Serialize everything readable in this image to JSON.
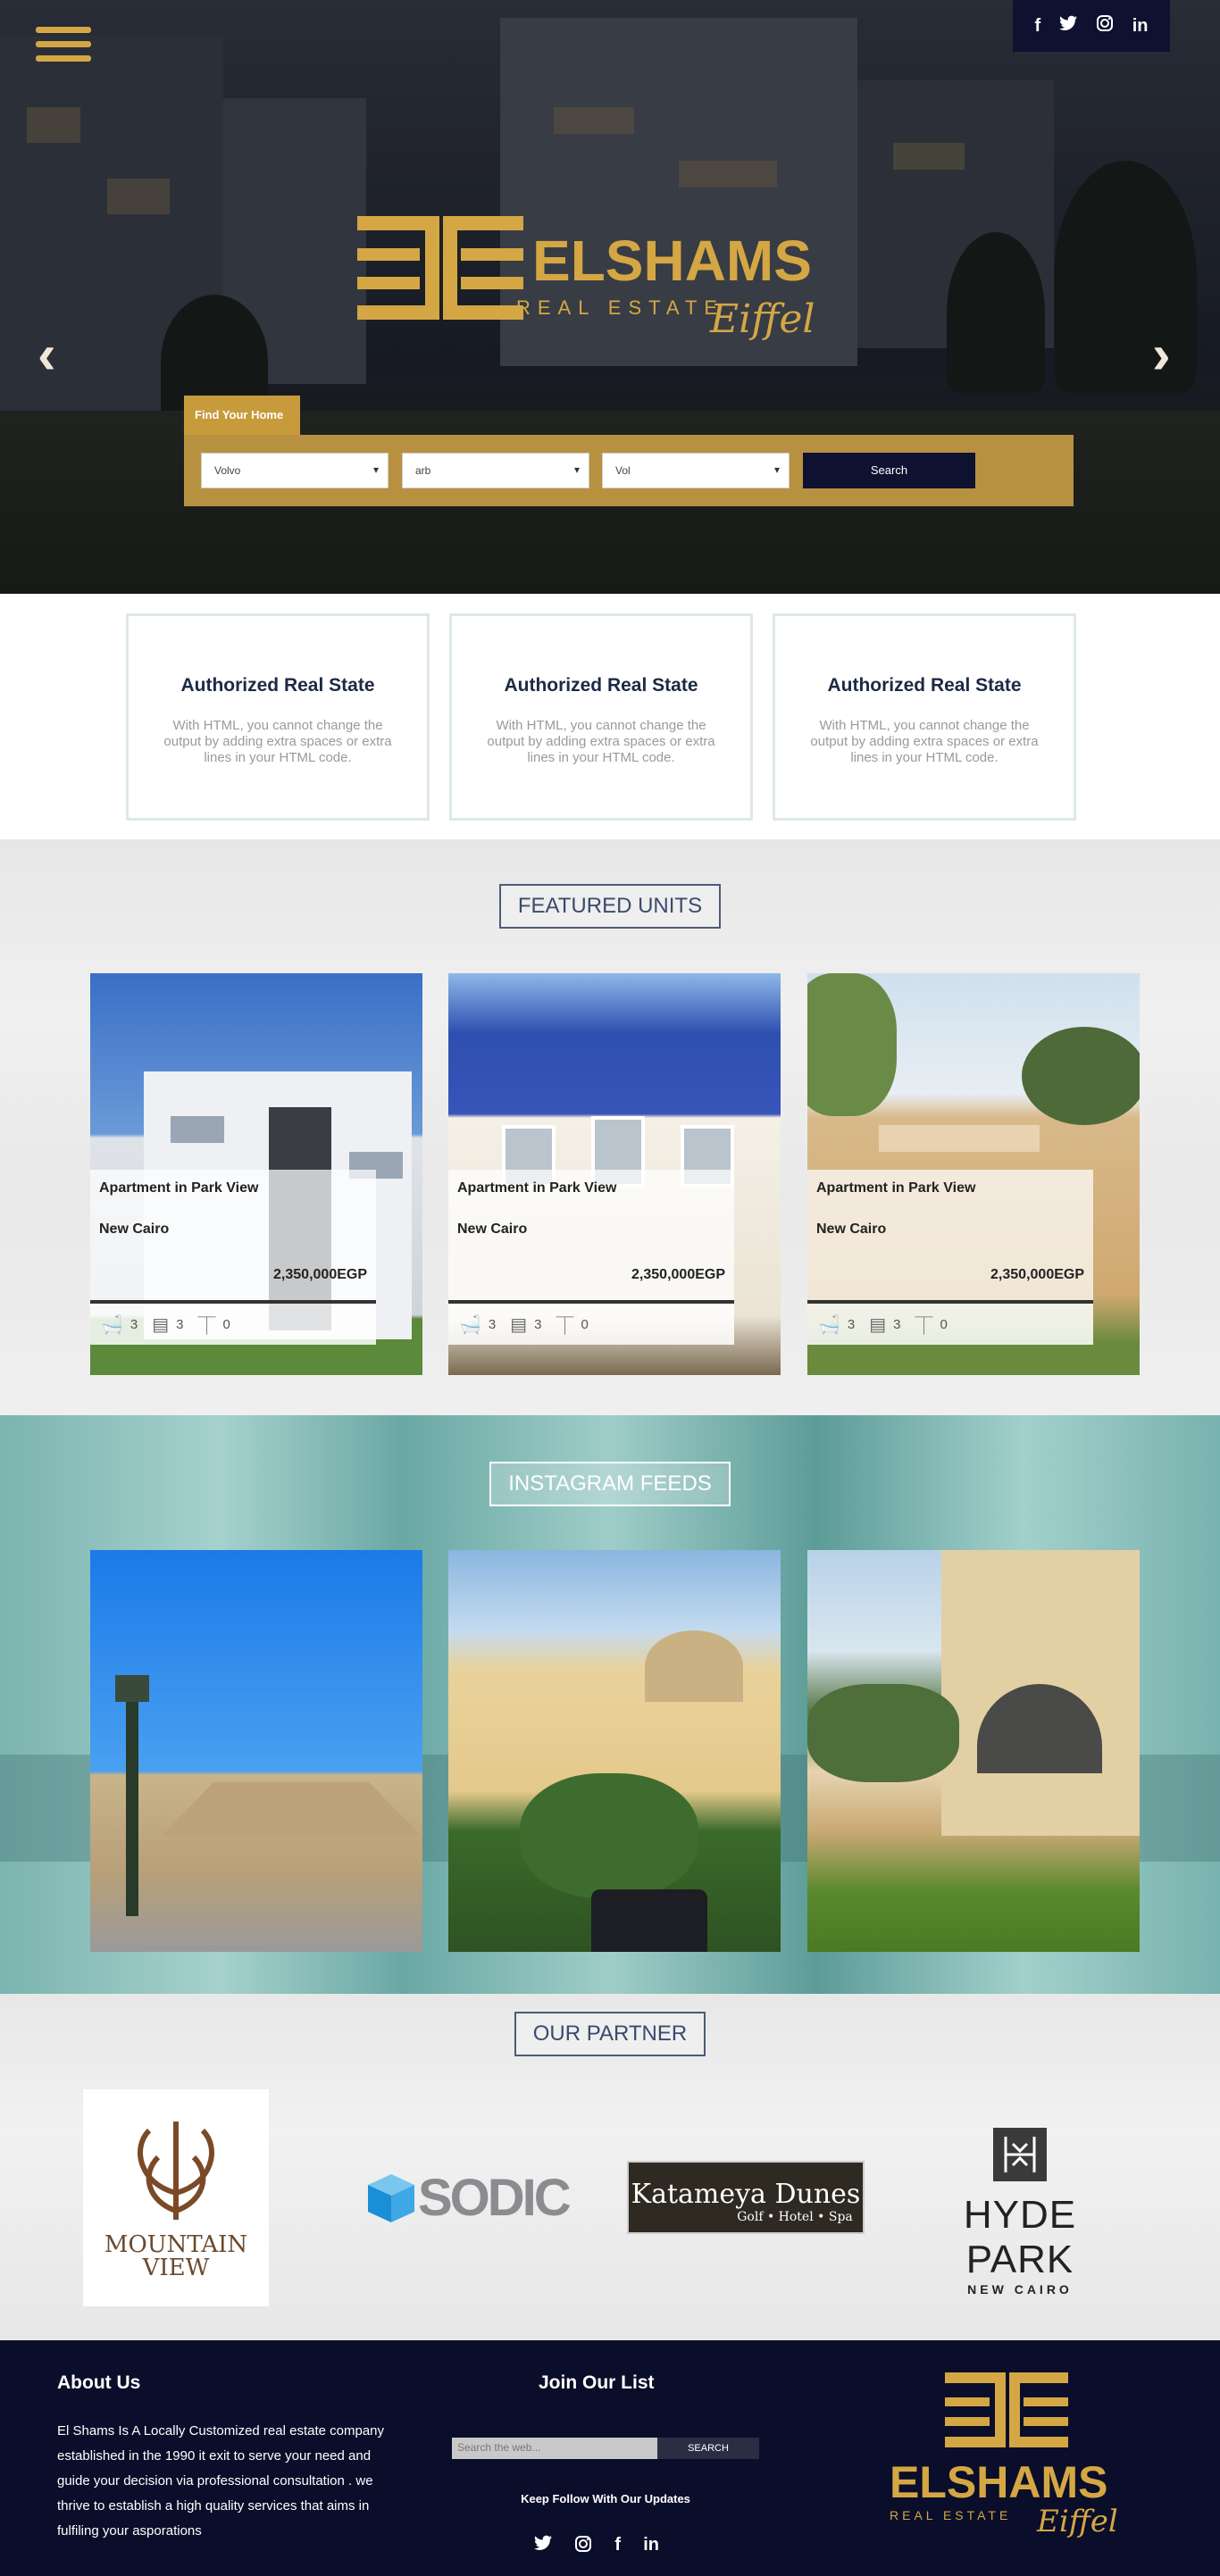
{
  "header": {
    "social": [
      {
        "name": "facebook-icon",
        "glyph": "f"
      },
      {
        "name": "twitter-icon",
        "glyph": "🐦"
      },
      {
        "name": "instagram-icon",
        "glyph": "◎"
      },
      {
        "name": "linkedin-icon",
        "glyph": "in"
      }
    ],
    "logo": {
      "brand": "ELSHAMS",
      "sub": "REAL ESTATE",
      "script": "Eiffel"
    },
    "prev_arrow": "‹",
    "next_arrow": "›"
  },
  "search": {
    "tab_label": "Find Your Home",
    "select1": "Volvo",
    "select2": "arb",
    "select3": "Vol",
    "button": "Search"
  },
  "features": [
    {
      "title": "Authorized Real State",
      "text": "With HTML, you cannot change the output by adding extra spaces or extra lines in your HTML code."
    },
    {
      "title": "Authorized Real State",
      "text": "With HTML, you cannot change the output by adding extra spaces or extra lines in your HTML code."
    },
    {
      "title": "Authorized Real State",
      "text": "With HTML, you cannot change the output by adding extra spaces or extra lines in your HTML code."
    }
  ],
  "units": {
    "title": "FEATURED UNITS",
    "cards": [
      {
        "title": "Apartment in Park View",
        "location": "New Cairo",
        "price": "2,350,000EGP",
        "baths": "3",
        "beds": "3",
        "other": "0"
      },
      {
        "title": "Apartment in Park View",
        "location": "New Cairo",
        "price": "2,350,000EGP",
        "baths": "3",
        "beds": "3",
        "other": "0"
      },
      {
        "title": "Apartment in Park View",
        "location": "New Cairo",
        "price": "2,350,000EGP",
        "baths": "3",
        "beds": "3",
        "other": "0"
      }
    ]
  },
  "instagram": {
    "title": "INSTAGRAM FEEDS"
  },
  "partners": {
    "title": "OUR PARTNER",
    "mountain": {
      "line1": "MOUNTAIN",
      "line2": "VIEW"
    },
    "sodic": "SODIC",
    "katameya": {
      "name": "Katameya Dunes",
      "tag": "Golf • Hotel • Spa"
    },
    "hydepark": {
      "name": "HYDE PARK",
      "sub": "NEW CAIRO"
    }
  },
  "footer": {
    "about_title": "About Us",
    "about_text": "El Shams Is A Locally Customized real estate company established in the 1990 it exit to serve your need and guide your decision via professional consultation . we thrive to establish a high quality services that aims in fulfiling your asporations",
    "join_title": "Join Our List",
    "search_placeholder": "Search the web...",
    "subscribe_button": "SEARCH",
    "keep_follow": "Keep Follow With Our Updates"
  },
  "colors": {
    "gold": "#d4a744",
    "navy": "#0e1230",
    "teal": "#7bb4b0"
  }
}
